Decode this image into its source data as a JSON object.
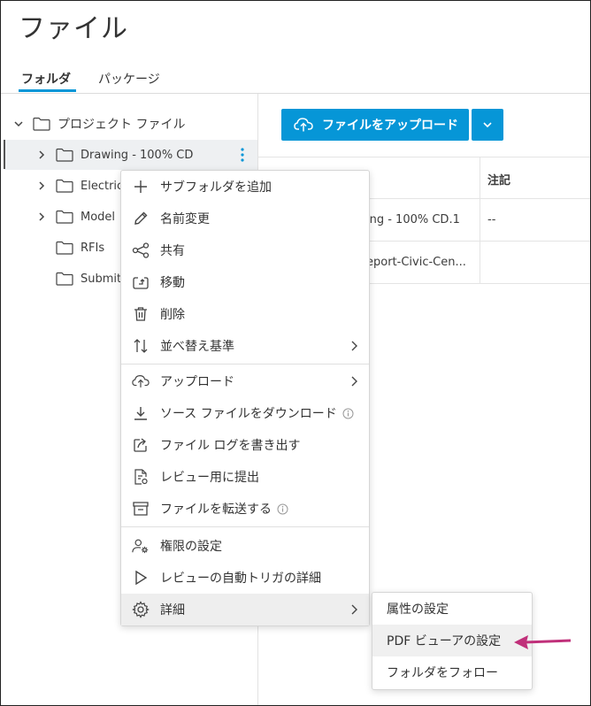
{
  "page": {
    "title": "ファイル"
  },
  "tabs": [
    {
      "label": "フォルダ"
    },
    {
      "label": "パッケージ"
    }
  ],
  "tree": {
    "root": "プロジェクト ファイル",
    "items": [
      {
        "label": "Drawing - 100% CD"
      },
      {
        "label": "Electric"
      },
      {
        "label": "Model"
      },
      {
        "label": "RFIs"
      },
      {
        "label": "Submit"
      }
    ]
  },
  "toolbar": {
    "upload_label": "ファイルをアップロード"
  },
  "table": {
    "col_notes": "注記",
    "rows": [
      {
        "name": "ing - 100% CD.1",
        "notes": "--"
      },
      {
        "name": "eport-Civic-Cen...",
        "notes": ""
      }
    ]
  },
  "context_menu": {
    "items": [
      {
        "label": "サブフォルダを追加",
        "icon": "plus-icon"
      },
      {
        "label": "名前変更",
        "icon": "pencil-icon"
      },
      {
        "label": "共有",
        "icon": "share-icon"
      },
      {
        "label": "移動",
        "icon": "move-icon"
      },
      {
        "label": "削除",
        "icon": "trash-icon"
      },
      {
        "label": "並べ替え基準",
        "icon": "sort-icon"
      },
      {
        "label": "アップロード",
        "icon": "cloud-upload-icon"
      },
      {
        "label": "ソース ファイルをダウンロード",
        "icon": "download-icon"
      },
      {
        "label": "ファイル ログを書き出す",
        "icon": "export-icon"
      },
      {
        "label": "レビュー用に提出",
        "icon": "review-icon"
      },
      {
        "label": "ファイルを転送する",
        "icon": "archive-icon"
      },
      {
        "label": "権限の設定",
        "icon": "user-gear-icon"
      },
      {
        "label": "レビューの自動トリガの詳細",
        "icon": "play-icon"
      },
      {
        "label": "詳細",
        "icon": "gear-icon"
      }
    ]
  },
  "submenu": {
    "items": [
      {
        "label": "属性の設定"
      },
      {
        "label": "PDF ビューアの設定"
      },
      {
        "label": "フォルダをフォロー"
      }
    ]
  },
  "colors": {
    "accent": "#0696d7",
    "annotation_arrow": "#c0307a"
  }
}
